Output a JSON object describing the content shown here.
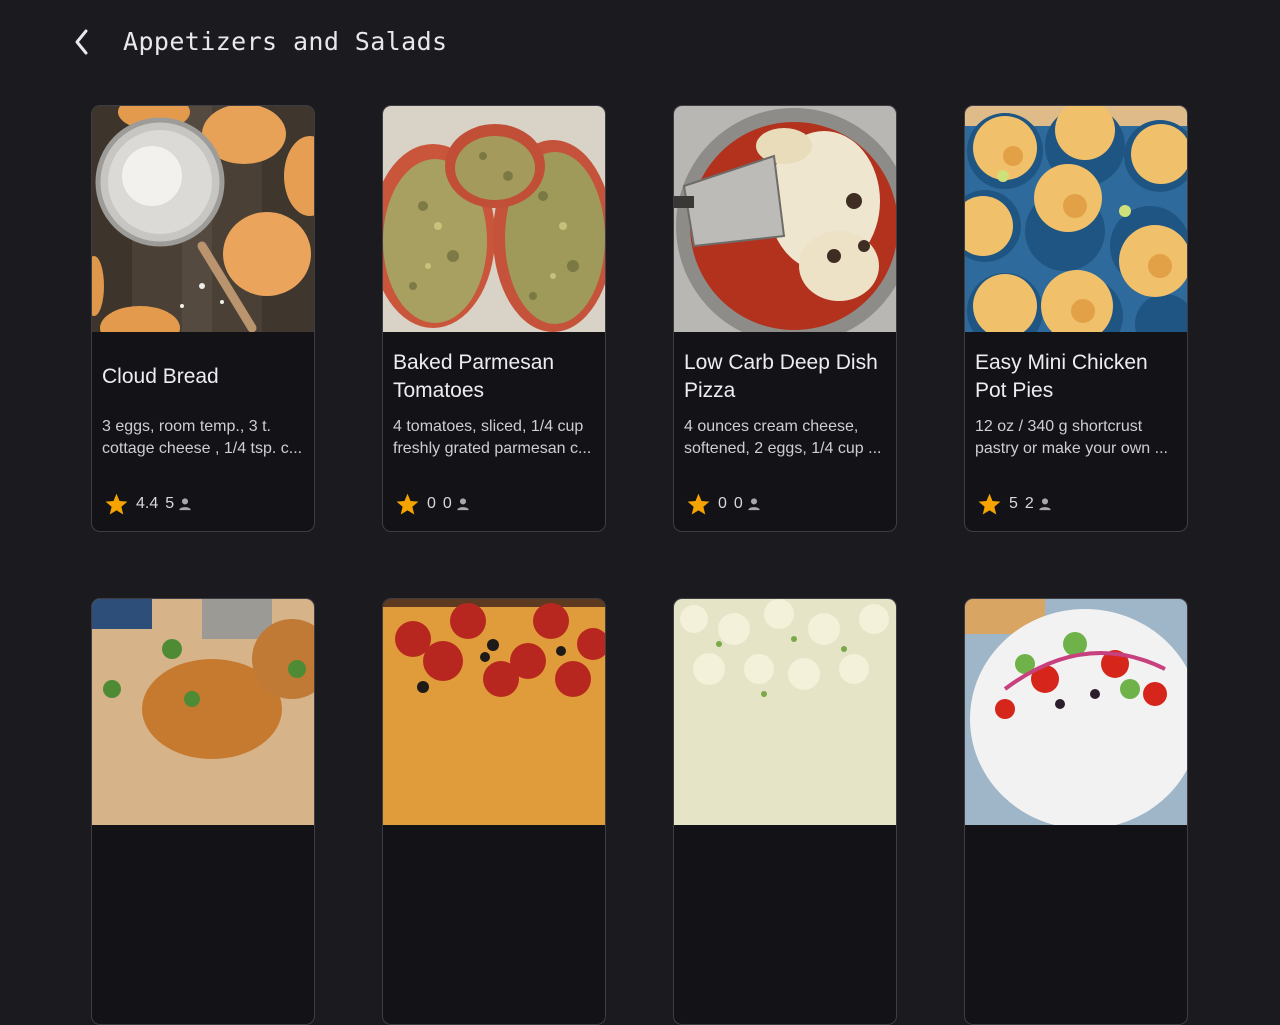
{
  "header": {
    "title": "Appetizers and Salads",
    "back_icon": "chevron-left-icon"
  },
  "colors": {
    "background": "#1b1a1f",
    "card": "#131216",
    "card_border": "#3f3d44",
    "star": "#f4a300"
  },
  "cards": [
    {
      "title": "Cloud Bread",
      "description": "3 eggs, room temp., 3 t. cottage cheese , 1/4 tsp. c...",
      "rating": "4.4",
      "reviews": "5",
      "image": "cloud-bread-photo"
    },
    {
      "title": "Baked Parmesan Tomatoes",
      "description": "4 tomatoes, sliced, 1/4 cup freshly grated parmesan c...",
      "rating": "0",
      "reviews": "0",
      "image": "parmesan-tomatoes-photo"
    },
    {
      "title": "Low Carb Deep Dish Pizza",
      "description": "4 ounces cream cheese, softened, 2 eggs, 1/4 cup ...",
      "rating": "0",
      "reviews": "0",
      "image": "deep-dish-pizza-photo"
    },
    {
      "title": "Easy Mini Chicken Pot Pies",
      "description": "12 oz / 340 g shortcrust pastry or make your own ...",
      "rating": "5",
      "reviews": "2",
      "image": "mini-pot-pies-photo"
    },
    {
      "title": "",
      "description": "",
      "rating": "",
      "reviews": "",
      "image": "patties-photo"
    },
    {
      "title": "",
      "description": "",
      "rating": "",
      "reviews": "",
      "image": "pepperoni-pizza-photo"
    },
    {
      "title": "",
      "description": "",
      "rating": "",
      "reviews": "",
      "image": "cauliflower-salad-photo"
    },
    {
      "title": "",
      "description": "",
      "rating": "",
      "reviews": "",
      "image": "greek-salad-photo"
    }
  ]
}
